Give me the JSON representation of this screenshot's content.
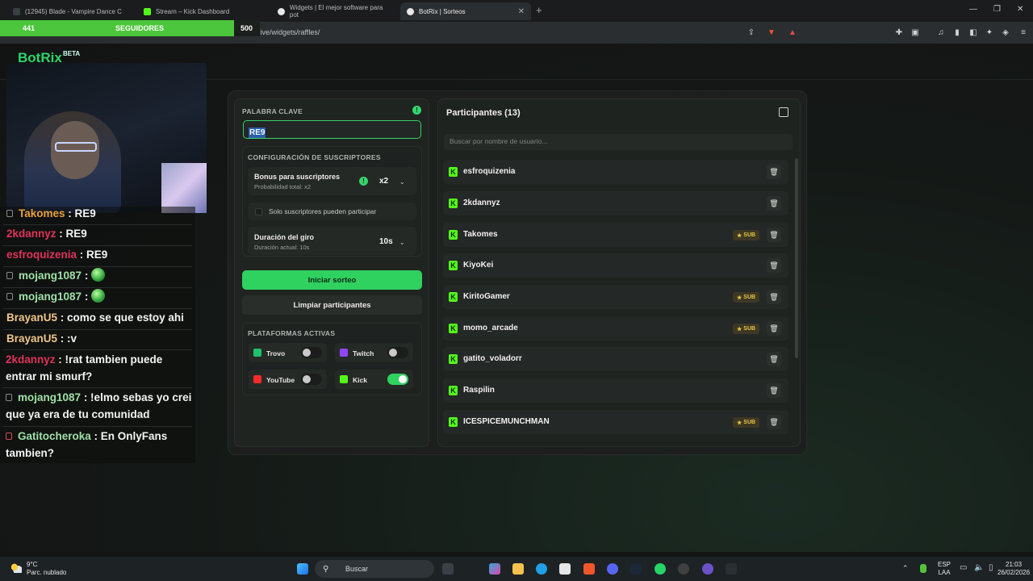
{
  "browser": {
    "tabs": [
      {
        "label": "(12945) Blade - Vampire Dance C"
      },
      {
        "label": "Stream – Kick Dashboard"
      },
      {
        "label": "Widgets | El mejor software para pot"
      },
      {
        "label": "BotRix | Sorteos"
      }
    ],
    "url": "botrix.live/widgets/raffles/"
  },
  "overlay": {
    "followers_current": "441",
    "followers_label": "SEGUIDORES",
    "followers_goal": "500"
  },
  "site": {
    "brand": "BotRix",
    "beta": "BETA"
  },
  "chat": {
    "messages": [
      {
        "user": "Takomes",
        "text": ": RE9",
        "color": "#e9a23b"
      },
      {
        "user": "2kdannyz",
        "text": ": RE9",
        "color": "#e0335a"
      },
      {
        "user": "esfroquizenia",
        "text": ": RE9",
        "color": "#e0335a"
      },
      {
        "user": "mojang1087",
        "text": ":",
        "color": "#9fe0a6"
      },
      {
        "user": "mojang1087",
        "text": ":",
        "color": "#9fe0a6"
      },
      {
        "user": "BrayanU5",
        "text": ": como se que estoy ahi",
        "color": "#f1c58a"
      },
      {
        "user": "BrayanU5",
        "text": ": :v",
        "color": "#f1c58a"
      },
      {
        "user": "2kdannyz",
        "text": ": !rat tambien puede entrar mi smurf?",
        "color": "#e0335a"
      },
      {
        "user": "mojang1087",
        "text": ": !elmo sebas yo crei que ya era de tu comunidad",
        "color": "#9fe0a6"
      },
      {
        "user": "Gatitocheroka",
        "text": ": En OnlyFans tambien?",
        "color": "#9fe0a6"
      }
    ]
  },
  "raffle": {
    "keyword_label": "PALABRA CLAVE",
    "keyword_value": "RE9",
    "subs_section": "CONFIGURACIÓN DE SUSCRIPTORES",
    "bonus_title": "Bonus para suscriptores",
    "bonus_sub": "Probabilidad total: x2",
    "bonus_value": "x2",
    "subs_only": "Solo suscriptores pueden participar",
    "spin_title": "Duración del giro",
    "spin_sub": "Duración actual: 10s",
    "spin_value": "10s",
    "start_button": "Iniciar sorteo",
    "clear_button": "Limpiar participantes",
    "platforms_label": "PLATAFORMAS ACTIVAS",
    "platforms": [
      {
        "name": "Trovo",
        "enabled": false,
        "color": "#1ec26b"
      },
      {
        "name": "Twitch",
        "enabled": false,
        "color": "#9146ff"
      },
      {
        "name": "YouTube",
        "enabled": false,
        "color": "#ff2b2b"
      },
      {
        "name": "Kick",
        "enabled": true,
        "color": "#53fc18"
      }
    ]
  },
  "participants": {
    "title": "Participantes (13)",
    "search_placeholder": "Buscar por nombre de usuario...",
    "sub_badge": "SUB",
    "list": [
      {
        "name": "esfroquizenia",
        "sub": false
      },
      {
        "name": "2kdannyz",
        "sub": false
      },
      {
        "name": "Takomes",
        "sub": true
      },
      {
        "name": "KiyoKei",
        "sub": false
      },
      {
        "name": "KiritoGamer",
        "sub": true
      },
      {
        "name": "momo_arcade",
        "sub": true
      },
      {
        "name": "gatito_voladorr",
        "sub": false
      },
      {
        "name": "Raspilin",
        "sub": false
      },
      {
        "name": "ICESPICEMUNCHMAN",
        "sub": true
      }
    ]
  },
  "taskbar": {
    "temp": "9°C",
    "weather": "Parc. nublado",
    "search": "Buscar",
    "lang1": "ESP",
    "lang2": "LAA",
    "time": "21:03",
    "date": "26/02/2026"
  },
  "colors": {
    "accent": "#2fd15f",
    "kick": "#53fc18",
    "sub_gold": "#e7c54a"
  }
}
